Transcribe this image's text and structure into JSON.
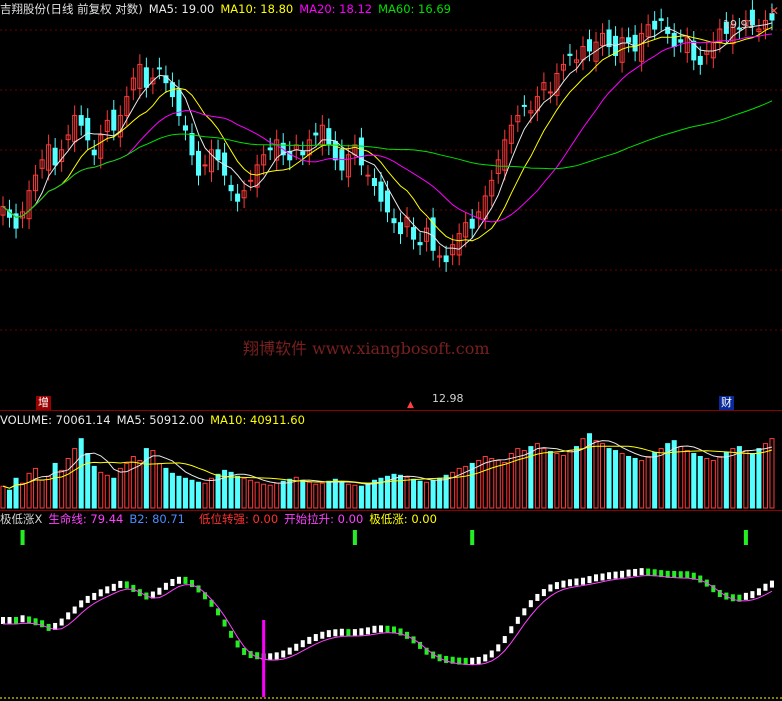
{
  "colors": {
    "up": "#ff3a3a",
    "down": "#54ffff",
    "ma5": "#e8e8e8",
    "ma10": "#ffff00",
    "ma20": "#ff00ff",
    "ma60": "#00e000",
    "bg": "#000000",
    "grid": "#8b0000"
  },
  "price_panel": {
    "stock_name": "吉翔股份(日线 前复权 对数)",
    "ma5_label": "MA5: 19.00",
    "ma10_label": "MA10: 18.80",
    "ma20_label": "MA20: 18.12",
    "ma60_label": "MA60: 16.69",
    "high_marker": "19.91",
    "low_marker": "12.98",
    "badge_left": "增",
    "badge_right": "财"
  },
  "volume_panel": {
    "volume_label": "VOLUME: 70061.14",
    "ma5_label": "MA5: 50912.00",
    "ma10_label": "MA10: 40911.60"
  },
  "indicator_panel": {
    "name": "极低涨X",
    "line1_label": "生命线: 79.44",
    "line2_label": "B2: 80.71",
    "sig1_label": "低位转强: 0.00",
    "sig2_label": "开始拉升: 0.00",
    "sig3_label": "极低涨: 0.00"
  },
  "watermark": "翔博软件 www.xiangbosoft.com",
  "chart_data": {
    "type": "candlestick",
    "price_closes": [
      16.0,
      15.8,
      15.6,
      15.9,
      16.3,
      16.6,
      16.9,
      17.2,
      16.8,
      17.1,
      17.4,
      17.8,
      17.6,
      17.3,
      17.0,
      17.4,
      17.7,
      17.5,
      17.8,
      18.2,
      18.6,
      18.9,
      18.4,
      18.6,
      18.8,
      18.5,
      18.2,
      17.8,
      17.5,
      17.0,
      16.6,
      16.8,
      17.1,
      16.9,
      16.6,
      16.3,
      16.1,
      16.3,
      16.5,
      16.8,
      17.0,
      17.1,
      17.3,
      17.0,
      16.9,
      17.2,
      17.0,
      17.3,
      17.4,
      17.6,
      17.2,
      16.9,
      16.7,
      17.0,
      17.2,
      16.8,
      16.6,
      16.4,
      16.1,
      15.9,
      15.7,
      15.5,
      15.8,
      15.4,
      15.3,
      15.6,
      15.2,
      15.1,
      15.0,
      15.3,
      15.5,
      15.7,
      15.6,
      15.9,
      16.2,
      16.5,
      16.9,
      17.3,
      17.6,
      17.8,
      18.0,
      17.9,
      18.2,
      18.5,
      18.3,
      18.7,
      18.9,
      19.1,
      19.0,
      19.3,
      19.2,
      19.4,
      19.6,
      19.3,
      19.1,
      19.5,
      19.4,
      19.2,
      19.6,
      19.8,
      19.7,
      19.9,
      19.6,
      19.3,
      19.4,
      19.5,
      19.0,
      18.9,
      19.2,
      19.4,
      19.7,
      19.6,
      19.8,
      19.7,
      19.9,
      19.8,
      19.7,
      19.9,
      19.91
    ],
    "volume_values": [
      22000,
      18000,
      30000,
      25000,
      35000,
      40000,
      28000,
      32000,
      45000,
      38000,
      50000,
      60000,
      70000,
      55000,
      42000,
      36000,
      33000,
      30000,
      40000,
      45000,
      52000,
      48000,
      60000,
      58000,
      45000,
      40000,
      35000,
      32000,
      30000,
      28000,
      26000,
      25000,
      30000,
      34000,
      38000,
      36000,
      32000,
      30000,
      28000,
      26000,
      24000,
      23000,
      25000,
      27000,
      29000,
      31000,
      28000,
      26000,
      24000,
      25000,
      27000,
      29000,
      26000,
      24000,
      23000,
      22000,
      25000,
      28000,
      30000,
      32000,
      34000,
      33000,
      31000,
      29000,
      27000,
      26000,
      28000,
      30000,
      33000,
      36000,
      40000,
      42000,
      45000,
      48000,
      52000,
      50000,
      48000,
      46000,
      55000,
      60000,
      58000,
      62000,
      65000,
      60000,
      57000,
      55000,
      53000,
      58000,
      62000,
      70000,
      75000,
      68000,
      65000,
      60000,
      58000,
      55000,
      52000,
      50000,
      48000,
      52000,
      56000,
      60000,
      65000,
      68000,
      62000,
      58000,
      55000,
      52000,
      50000,
      48000,
      52000,
      56000,
      60000,
      62000,
      58000,
      55000,
      60000,
      65000,
      70061
    ],
    "indicator_line_lifeline": 79.44,
    "indicator_line_b2": 80.71,
    "price_ylim": [
      12.98,
      19.91
    ]
  }
}
